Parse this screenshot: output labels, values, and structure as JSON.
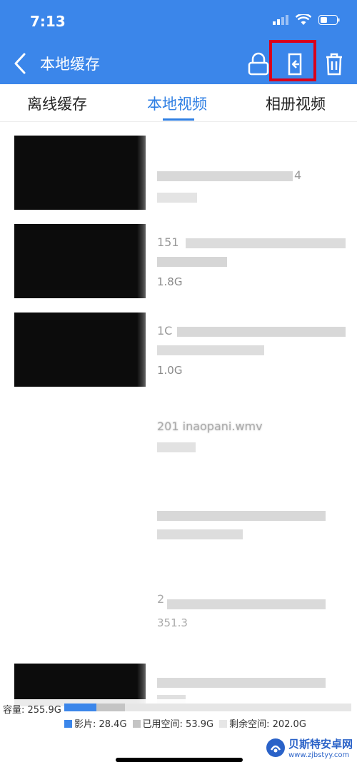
{
  "status": {
    "time": "7:13"
  },
  "header": {
    "title": "本地缓存"
  },
  "tabs": [
    {
      "label": "离线缓存",
      "active": false
    },
    {
      "label": "本地视频",
      "active": true
    },
    {
      "label": "相册视频",
      "active": false
    }
  ],
  "videos": [
    {
      "title": "4",
      "size": "",
      "thumbnail": true
    },
    {
      "title": "151",
      "size": "1.8G",
      "thumbnail": true
    },
    {
      "title": "1C",
      "size": "1.0G",
      "thumbnail": true
    },
    {
      "title": "201 inaopani.wmv",
      "size": "",
      "thumbnail": false
    },
    {
      "title": "",
      "size": "",
      "thumbnail": false
    },
    {
      "title": "2",
      "size": "351.3",
      "thumbnail": false
    },
    {
      "title": "",
      "size": "",
      "thumbnail": true
    }
  ],
  "storage": {
    "capacity_label": "容量: 255.9G",
    "video_label": "影片: 28.4G",
    "used_label": "已用空间: 53.9G",
    "free_label": "剩余空间: 202.0G",
    "video_fraction": 0.111,
    "used_fraction": 0.211
  },
  "colors": {
    "accent": "#3b86ea",
    "active_tab": "#2f7fe3",
    "highlight": "#d9001b",
    "used": "#c4c4c4",
    "free": "#e6e6e6"
  },
  "watermark": {
    "name": "贝斯特安卓网",
    "url": "www.zjbstyy.com"
  }
}
